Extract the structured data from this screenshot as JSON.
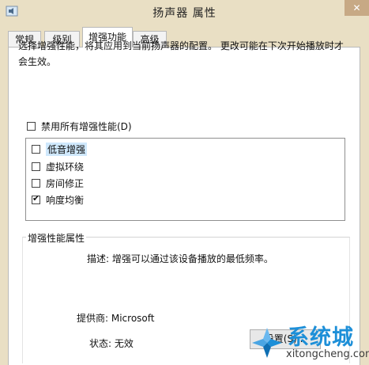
{
  "window": {
    "title": "扬声器 属性",
    "close_glyph": "✕"
  },
  "tabs": [
    {
      "label": "常规",
      "active": false
    },
    {
      "label": "级别",
      "active": false
    },
    {
      "label": "增强功能",
      "active": true
    },
    {
      "label": "高级",
      "active": false
    }
  ],
  "enhancements": {
    "description": "选择增强性能，将其应用到当前扬声器的配置。 更改可能在下次开始播放时才会生效。",
    "disable_all": {
      "label": "禁用所有增强性能(D)",
      "checked": false
    },
    "items": [
      {
        "label": "低音增强",
        "checked": false,
        "selected": true
      },
      {
        "label": "虚拟环绕",
        "checked": false,
        "selected": false
      },
      {
        "label": "房间修正",
        "checked": false,
        "selected": false
      },
      {
        "label": "响度均衡",
        "checked": true,
        "selected": false
      }
    ]
  },
  "properties": {
    "group_title": "增强性能属性",
    "description": "描述: 增强可以通过该设备播放的最低频率。",
    "provider": "提供商: Microsoft",
    "status": "状态: 无效",
    "settings_button": "设置(S)..."
  },
  "watermark": {
    "main": "系统城",
    "sub": "xitongcheng.com"
  },
  "colors": {
    "frame": "#e9dfc4",
    "selection": "#cfe8fc",
    "watermark_blue": "#1d8fd8"
  }
}
